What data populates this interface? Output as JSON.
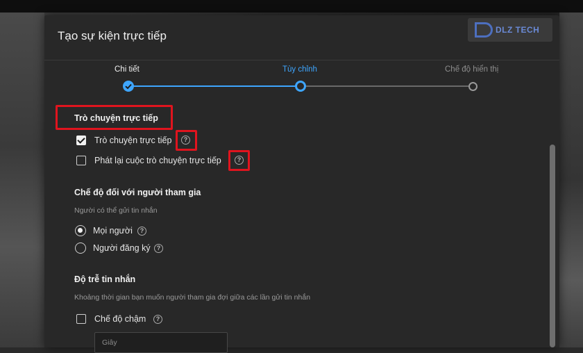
{
  "dialog": {
    "title": "Tạo sự kiện trực tiếp",
    "watermark": "DLZ TECH"
  },
  "stepper": {
    "steps": [
      {
        "label": "Chi tiết",
        "state": "done"
      },
      {
        "label": "Tùy chỉnh",
        "state": "current"
      },
      {
        "label": "Chế độ hiển thị",
        "state": "upcoming"
      }
    ],
    "accent_color": "#3ea6ff"
  },
  "live_chat": {
    "title": "Trò chuyện trực tiếp",
    "options": [
      {
        "label": "Trò chuyện trực tiếp",
        "checked": true
      },
      {
        "label": "Phát lại cuộc trò chuyện trực tiếp",
        "checked": false
      }
    ]
  },
  "participant_mode": {
    "title": "Chế độ đối với người tham gia",
    "subtitle": "Người có thể gửi tin nhắn",
    "options": [
      {
        "label": "Mọi người",
        "selected": true
      },
      {
        "label": "Người đăng ký",
        "selected": false
      }
    ]
  },
  "message_delay": {
    "title": "Độ trễ tin nhắn",
    "subtitle": "Khoảng thời gian bạn muốn người tham gia đợi giữa các lần gửi tin nhắn",
    "slow_mode_label": "Chế độ chậm",
    "slow_mode_checked": false,
    "seconds_placeholder": "Giây"
  },
  "icons": {
    "help": "help-circle-icon",
    "check": "check-icon"
  },
  "highlight_color": "#e0141e"
}
